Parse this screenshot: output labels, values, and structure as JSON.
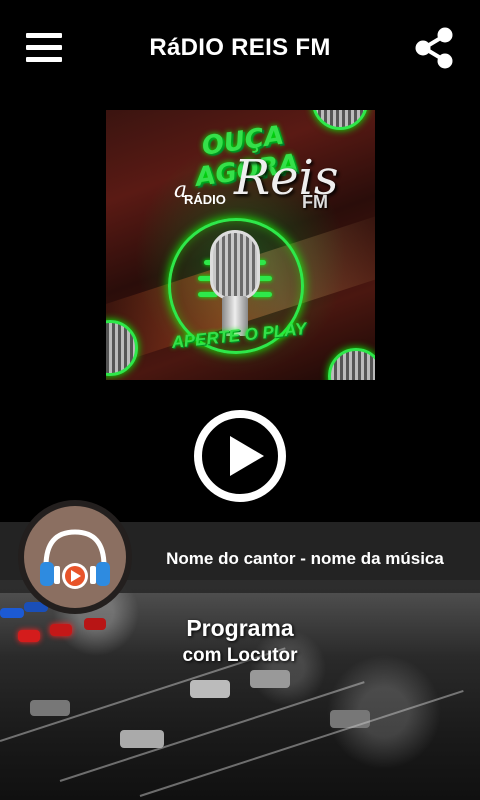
{
  "header": {
    "title": "RáDIO REIS FM",
    "menu_icon": "hamburger-menu-icon",
    "share_icon": "share-icon"
  },
  "cover": {
    "line1": "OUÇA AGORA",
    "line2_a": "a",
    "line2_radio": "RÁDIO",
    "brand": "Reis",
    "brand_fm": "FM",
    "cta": "APERTE O PLAY"
  },
  "player": {
    "play_icon": "play-icon"
  },
  "now_playing": {
    "track": "Nome do cantor - nome da música",
    "avatar_icon": "headphones-icon"
  },
  "program": {
    "title": "Programa",
    "host": "com Locutor"
  },
  "colors": {
    "accent_green": "#2ee84a",
    "headphone_blue": "#2e8be0",
    "headphone_orange": "#e8542a",
    "avatar_bg": "#8b6f61"
  }
}
